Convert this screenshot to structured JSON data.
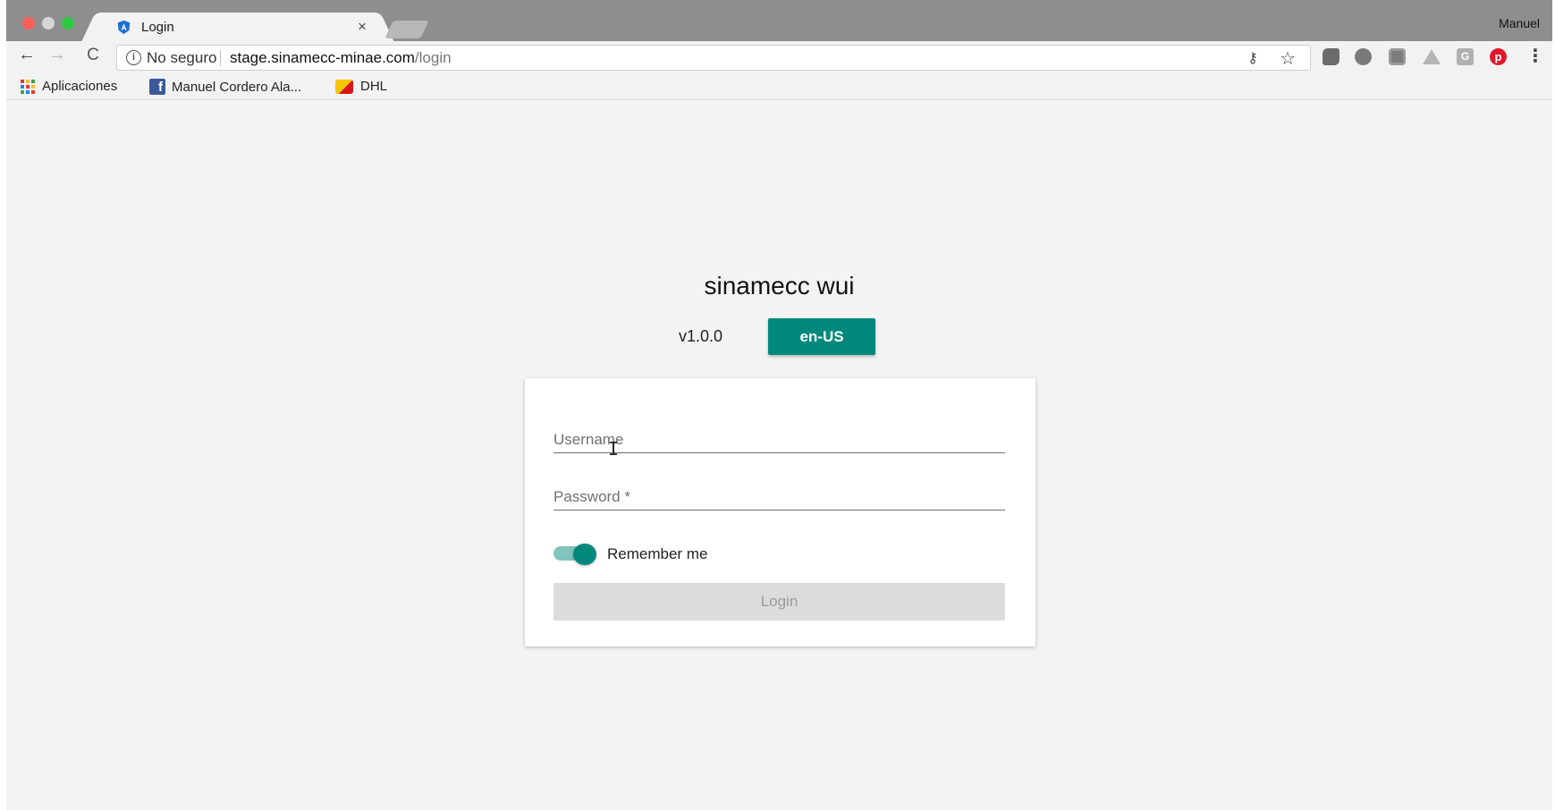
{
  "browser": {
    "tab": {
      "title": "Login",
      "close_glyph": "×"
    },
    "profile_name": "Manuel",
    "omnibox": {
      "security_label": "No seguro",
      "url_host": "stage.sinamecc-minae.com",
      "url_path": "/login"
    },
    "bookmarks": [
      {
        "label": "Aplicaciones",
        "icon": "apps-grid-icon"
      },
      {
        "label": "Manuel Cordero Ala...",
        "icon": "facebook-icon"
      },
      {
        "label": "DHL",
        "icon": "dhl-icon"
      }
    ],
    "extensions": [
      "evernote-icon",
      "chat-bubble-icon",
      "square-icon",
      "drive-icon",
      "google-icon",
      "pinterest-icon"
    ]
  },
  "app": {
    "title": "sinamecc wui",
    "version": "v1.0.0",
    "language_button": "en-US"
  },
  "login_form": {
    "username_placeholder": "Username",
    "password_placeholder": "Password *",
    "remember_me_label": "Remember me",
    "remember_me_checked": true,
    "login_button": "Login"
  },
  "colors": {
    "accent": "#00897b",
    "accent_light": "#7fc4bd",
    "page_bg": "#f3f3f3",
    "disabled_button_bg": "#dcdcdc"
  }
}
